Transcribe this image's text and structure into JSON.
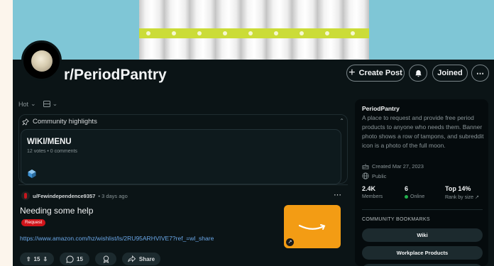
{
  "colors": {
    "page_bg": "#0b1416",
    "accent_link": "#6aa7e8",
    "flair_red": "#d1141a",
    "online_green": "#21b14d",
    "banner_sky": "#7fc6d6",
    "thumb_orange": "#f39c14"
  },
  "header": {
    "subreddit": "r/PeriodPantry",
    "create_post_label": "Create Post",
    "joined_label": "Joined",
    "icons": {
      "create": "plus-icon",
      "bell": "bell-icon",
      "more": "ellipsis-icon"
    }
  },
  "feed": {
    "sort_label": "Hot",
    "highlights": {
      "title": "Community highlights",
      "card": {
        "title": "WIKI/MENU",
        "meta": "12 votes • 0 comments"
      }
    },
    "post": {
      "author": "u/Fewindependence9357",
      "time": "• 3 days ago",
      "title": "Needing some help",
      "flair": "Request",
      "link": "https://www.amazon.com/hz/wishlist/ls/2RU95ARHVIVE7?ref_=wl_share",
      "votes": "15",
      "comments": "15",
      "share_label": "Share"
    }
  },
  "sidebar": {
    "name": "PeriodPantry",
    "description": "A place to request and provide free period products to anyone who needs them. Banner photo shows a row of tampons, and subreddit icon is a photo of the full moon.",
    "created": "Created Mar 27, 2023",
    "visibility": "Public",
    "stats": [
      {
        "value": "2.4K",
        "label": "Members"
      },
      {
        "value": "6",
        "label": "Online"
      },
      {
        "value": "Top 14%",
        "label": "Rank by size"
      }
    ],
    "bookmarks_heading": "COMMUNITY BOOKMARKS",
    "bookmarks": [
      "Wiki",
      "Workplace Products",
      ""
    ]
  }
}
